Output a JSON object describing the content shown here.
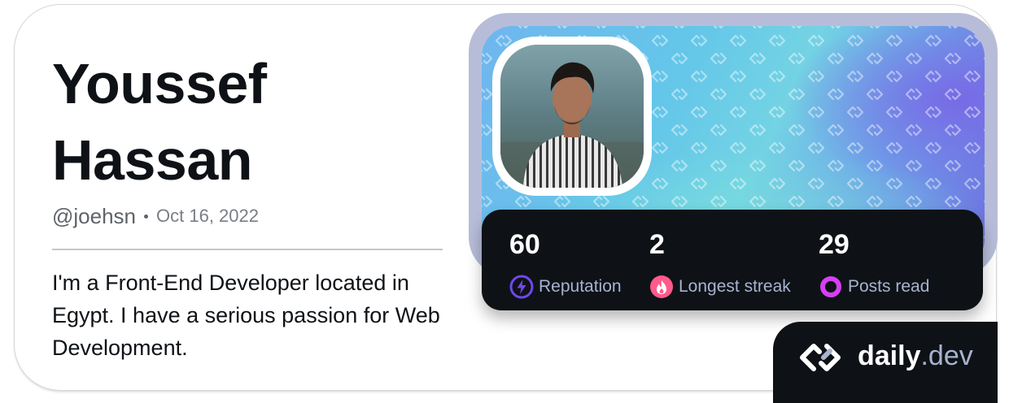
{
  "profile": {
    "name": "Youssef Hassan",
    "handle": "@joehsn",
    "joined": "Oct 16, 2022",
    "bio": "I'm a Front-End Developer located in Egypt. I have a serious passion for Web Development."
  },
  "stats": [
    {
      "value": "60",
      "label": "Reputation",
      "icon": "bolt-icon",
      "color": "#7147ed"
    },
    {
      "value": "2",
      "label": "Longest streak",
      "icon": "flame-icon",
      "color": "#ff5a8c"
    },
    {
      "value": "29",
      "label": "Posts read",
      "icon": "ring-icon",
      "color": "#d63ff3"
    }
  ],
  "brand": {
    "name": "daily",
    "tld": ".dev"
  },
  "colors": {
    "card_dark": "#0e1217",
    "label_gray": "#a8b3cf",
    "frame": "#b7bdd9"
  }
}
